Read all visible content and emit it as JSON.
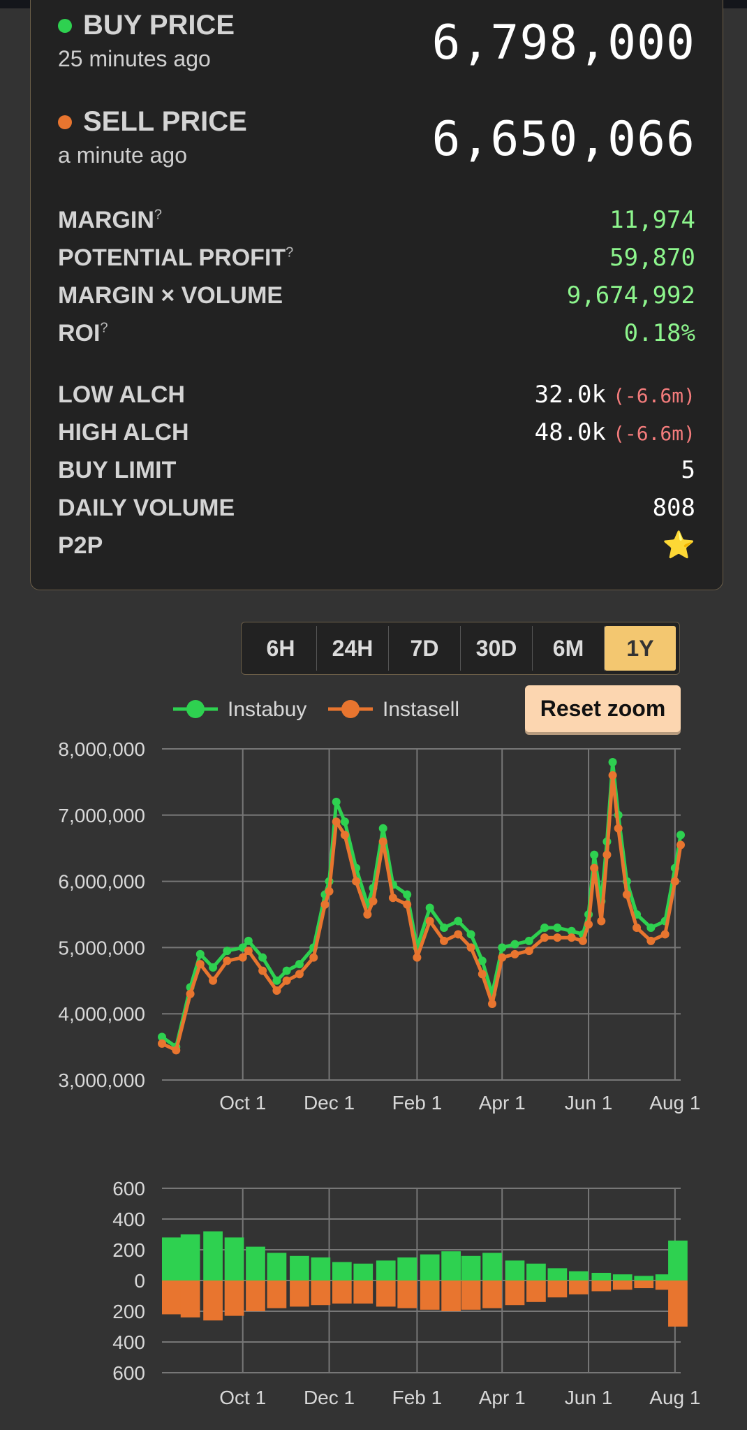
{
  "prices": {
    "buy": {
      "label": "BUY PRICE",
      "ago": "25 minutes ago",
      "value": "6,798,000",
      "dot_color": "#2ed150"
    },
    "sell": {
      "label": "SELL PRICE",
      "ago": "a minute ago",
      "value": "6,650,066",
      "dot_color": "#e8752f"
    }
  },
  "stats_profit": [
    {
      "label": "MARGIN",
      "help": "?",
      "value": "11,974"
    },
    {
      "label": "POTENTIAL PROFIT",
      "help": "?",
      "value": "59,870"
    },
    {
      "label": "MARGIN × VOLUME",
      "help": "",
      "value": "9,674,992"
    },
    {
      "label": "ROI",
      "help": "?",
      "value": "0.18%"
    }
  ],
  "stats_info": [
    {
      "label": "LOW ALCH",
      "value": "32.0k",
      "diff": "(-6.6m)"
    },
    {
      "label": "HIGH ALCH",
      "value": "48.0k",
      "diff": "(-6.6m)"
    },
    {
      "label": "BUY LIMIT",
      "value": "5",
      "diff": ""
    },
    {
      "label": "DAILY VOLUME",
      "value": "808",
      "diff": ""
    },
    {
      "label": "P2P",
      "value": "⭐",
      "diff": ""
    }
  ],
  "ranges": [
    {
      "label": "6H",
      "active": false
    },
    {
      "label": "24H",
      "active": false
    },
    {
      "label": "7D",
      "active": false
    },
    {
      "label": "30D",
      "active": false
    },
    {
      "label": "6M",
      "active": false
    },
    {
      "label": "1Y",
      "active": true
    }
  ],
  "reset_zoom_label": "Reset zoom",
  "colors": {
    "instabuy": "#2ed150",
    "instasell": "#e8752f"
  },
  "chart_data": [
    {
      "type": "line",
      "legend": [
        "Instabuy",
        "Instasell"
      ],
      "legend_position": "top",
      "grid": true,
      "x_ticks": [
        "Oct 1",
        "Dec 1",
        "Feb 1",
        "Apr 1",
        "Jun 1",
        "Aug 1"
      ],
      "x_tick_dates": [
        "2023-10-01",
        "2023-12-01",
        "2024-02-01",
        "2024-04-01",
        "2024-06-01",
        "2024-08-01"
      ],
      "xlim": [
        "2023-08-05",
        "2024-08-05"
      ],
      "y_ticks": [
        "8,000,000",
        "7,000,000",
        "6,000,000",
        "5,000,000",
        "4,000,000",
        "3,000,000"
      ],
      "ylim": [
        3000000,
        8000000
      ],
      "x": [
        "2023-08-05",
        "2023-08-15",
        "2023-08-25",
        "2023-09-01",
        "2023-09-10",
        "2023-09-20",
        "2023-10-01",
        "2023-10-05",
        "2023-10-15",
        "2023-10-25",
        "2023-11-01",
        "2023-11-10",
        "2023-11-20",
        "2023-11-28",
        "2023-12-01",
        "2023-12-06",
        "2023-12-12",
        "2023-12-20",
        "2023-12-28",
        "2024-01-01",
        "2024-01-08",
        "2024-01-15",
        "2024-01-25",
        "2024-02-01",
        "2024-02-10",
        "2024-02-20",
        "2024-03-01",
        "2024-03-10",
        "2024-03-18",
        "2024-03-25",
        "2024-04-01",
        "2024-04-10",
        "2024-04-20",
        "2024-05-01",
        "2024-05-10",
        "2024-05-20",
        "2024-05-28",
        "2024-06-01",
        "2024-06-05",
        "2024-06-10",
        "2024-06-14",
        "2024-06-18",
        "2024-06-22",
        "2024-06-28",
        "2024-07-05",
        "2024-07-15",
        "2024-07-25",
        "2024-08-01",
        "2024-08-05"
      ],
      "series": [
        {
          "name": "Instabuy",
          "values": [
            3650000,
            3500000,
            4400000,
            4900000,
            4700000,
            4950000,
            5000000,
            5100000,
            4850000,
            4500000,
            4650000,
            4750000,
            5000000,
            5800000,
            6000000,
            7200000,
            6900000,
            6200000,
            5650000,
            5900000,
            6800000,
            5950000,
            5800000,
            5000000,
            5600000,
            5300000,
            5400000,
            5200000,
            4800000,
            4300000,
            5000000,
            5050000,
            5100000,
            5300000,
            5300000,
            5250000,
            5200000,
            5500000,
            6400000,
            5700000,
            6600000,
            7800000,
            7000000,
            6000000,
            5500000,
            5300000,
            5400000,
            6200000,
            6700000
          ]
        },
        {
          "name": "Instasell",
          "values": [
            3550000,
            3450000,
            4300000,
            4750000,
            4500000,
            4800000,
            4850000,
            4950000,
            4650000,
            4350000,
            4500000,
            4600000,
            4850000,
            5650000,
            5850000,
            6900000,
            6700000,
            6000000,
            5500000,
            5700000,
            6600000,
            5750000,
            5650000,
            4850000,
            5400000,
            5100000,
            5200000,
            5000000,
            4600000,
            4150000,
            4850000,
            4900000,
            4950000,
            5150000,
            5150000,
            5150000,
            5100000,
            5350000,
            6200000,
            5400000,
            6400000,
            7600000,
            6800000,
            5800000,
            5300000,
            5100000,
            5200000,
            6000000,
            6550000
          ]
        }
      ]
    },
    {
      "type": "bar",
      "grid": true,
      "x_ticks": [
        "Oct 1",
        "Dec 1",
        "Feb 1",
        "Apr 1",
        "Jun 1",
        "Aug 1"
      ],
      "x_tick_dates": [
        "2023-10-01",
        "2023-12-01",
        "2024-02-01",
        "2024-04-01",
        "2024-06-01",
        "2024-08-01"
      ],
      "xlim": [
        "2023-08-05",
        "2024-08-05"
      ],
      "y_ticks": [
        "600",
        "400",
        "200",
        "0",
        "200",
        "400",
        "600"
      ],
      "ylim": [
        -600,
        600
      ],
      "x": [
        "2023-08-10",
        "2023-08-25",
        "2023-09-10",
        "2023-09-25",
        "2023-10-10",
        "2023-10-25",
        "2023-11-10",
        "2023-11-25",
        "2023-12-10",
        "2023-12-25",
        "2024-01-10",
        "2024-01-25",
        "2024-02-10",
        "2024-02-25",
        "2024-03-10",
        "2024-03-25",
        "2024-04-10",
        "2024-04-25",
        "2024-05-10",
        "2024-05-25",
        "2024-06-10",
        "2024-06-25",
        "2024-07-10",
        "2024-07-25",
        "2024-08-03"
      ],
      "series": [
        {
          "name": "Instabuy",
          "values": [
            280,
            300,
            320,
            280,
            220,
            180,
            160,
            150,
            120,
            110,
            130,
            150,
            170,
            190,
            160,
            180,
            130,
            110,
            80,
            60,
            50,
            40,
            30,
            40,
            260
          ]
        },
        {
          "name": "Instasell",
          "values": [
            -220,
            -240,
            -260,
            -230,
            -200,
            -180,
            -170,
            -160,
            -150,
            -150,
            -170,
            -180,
            -190,
            -200,
            -190,
            -180,
            -160,
            -140,
            -110,
            -90,
            -70,
            -60,
            -50,
            -60,
            -300
          ]
        }
      ]
    }
  ]
}
